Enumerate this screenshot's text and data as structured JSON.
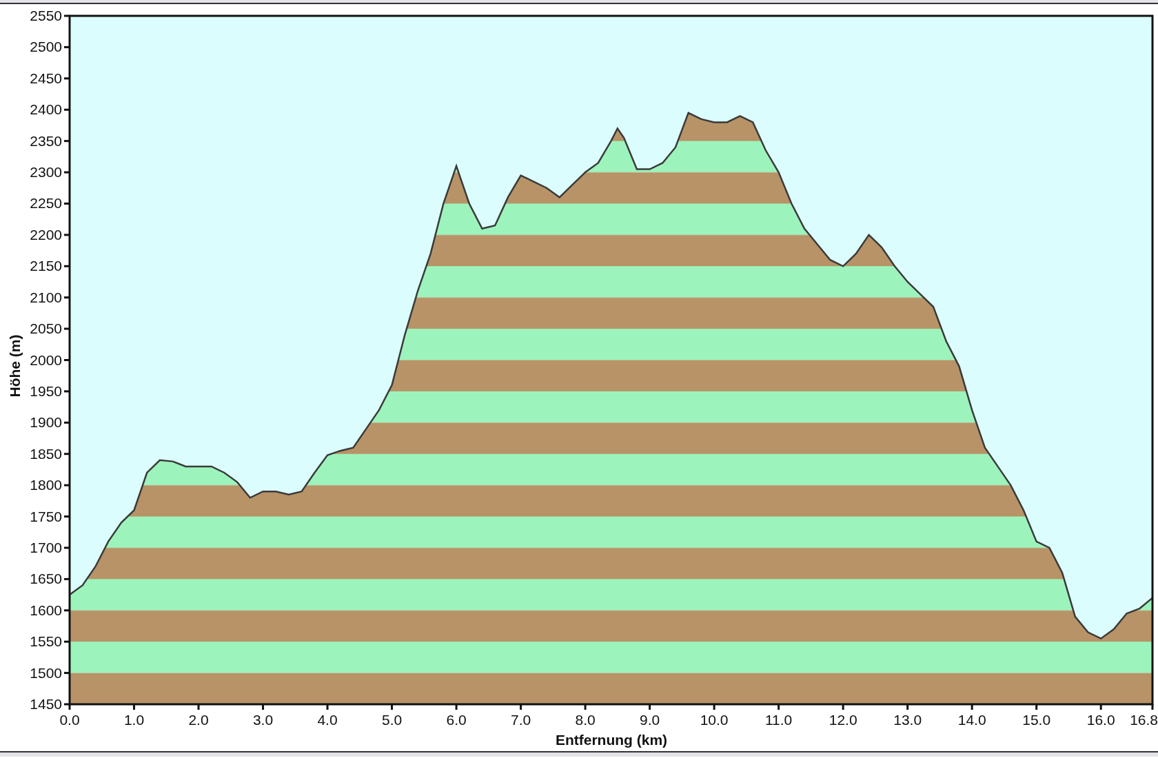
{
  "chart": {
    "chart_data": {
      "type": "area",
      "xlabel": "Entfernung  (km)",
      "ylabel": "Höhe (m)",
      "x": [
        0,
        0.2,
        0.4,
        0.6,
        0.8,
        1.0,
        1.2,
        1.4,
        1.6,
        1.8,
        2.0,
        2.2,
        2.4,
        2.6,
        2.8,
        3.0,
        3.2,
        3.4,
        3.6,
        3.8,
        4.0,
        4.2,
        4.4,
        4.6,
        4.8,
        5.0,
        5.2,
        5.4,
        5.6,
        5.8,
        6.0,
        6.2,
        6.4,
        6.6,
        6.8,
        7.0,
        7.2,
        7.4,
        7.6,
        7.8,
        8.0,
        8.2,
        8.4,
        8.5,
        8.6,
        8.8,
        9.0,
        9.2,
        9.4,
        9.6,
        9.8,
        10.0,
        10.2,
        10.4,
        10.6,
        10.8,
        11.0,
        11.2,
        11.4,
        11.6,
        11.8,
        12.0,
        12.2,
        12.4,
        12.6,
        12.8,
        13.0,
        13.2,
        13.4,
        13.6,
        13.8,
        14.0,
        14.2,
        14.4,
        14.6,
        14.8,
        15.0,
        15.2,
        15.4,
        15.6,
        15.8,
        16.0,
        16.2,
        16.4,
        16.6,
        16.8
      ],
      "series": [
        {
          "color": "#3a3a3a",
          "values": [
            1625,
            1640,
            1670,
            1710,
            1740,
            1760,
            1820,
            1840,
            1838,
            1830,
            1830,
            1830,
            1820,
            1805,
            1780,
            1790,
            1790,
            1785,
            1790,
            1820,
            1848,
            1855,
            1860,
            1890,
            1920,
            1960,
            2040,
            2110,
            2170,
            2250,
            2310,
            2250,
            2210,
            2215,
            2260,
            2295,
            2285,
            2275,
            2260,
            2280,
            2300,
            2315,
            2350,
            2370,
            2355,
            2305,
            2305,
            2315,
            2340,
            2395,
            2385,
            2380,
            2380,
            2390,
            2380,
            2335,
            2300,
            2250,
            2210,
            2185,
            2160,
            2150,
            2170,
            2200,
            2180,
            2150,
            2125,
            2105,
            2085,
            2030,
            1990,
            1920,
            1860,
            1830,
            1800,
            1760,
            1710,
            1700,
            1660,
            1590,
            1565,
            1555,
            1570,
            1595,
            1603,
            1620
          ]
        }
      ],
      "xlim": [
        0,
        16.8
      ],
      "ylim": [
        1450,
        2550
      ],
      "xticks": [
        {
          "value": 0,
          "label": "0.0"
        },
        {
          "value": 1,
          "label": "1.0"
        },
        {
          "value": 2,
          "label": "2.0"
        },
        {
          "value": 3,
          "label": "3.0"
        },
        {
          "value": 4,
          "label": "4.0"
        },
        {
          "value": 5,
          "label": "5.0"
        },
        {
          "value": 6,
          "label": "6.0"
        },
        {
          "value": 7,
          "label": "7.0"
        },
        {
          "value": 8,
          "label": "8.0"
        },
        {
          "value": 9,
          "label": "9.0"
        },
        {
          "value": 10,
          "label": "10.0"
        },
        {
          "value": 11,
          "label": "11.0"
        },
        {
          "value": 12,
          "label": "12.0"
        },
        {
          "value": 13,
          "label": "13.0"
        },
        {
          "value": 14,
          "label": "14.0"
        },
        {
          "value": 15,
          "label": "15.0"
        },
        {
          "value": 16,
          "label": "16.0"
        },
        {
          "value": 16.8,
          "label": "16.8"
        }
      ],
      "yticks": [
        1450,
        1500,
        1550,
        1600,
        1650,
        1700,
        1750,
        1800,
        1850,
        1900,
        1950,
        2000,
        2050,
        2100,
        2150,
        2200,
        2250,
        2300,
        2350,
        2400,
        2450,
        2500,
        2550
      ]
    }
  }
}
